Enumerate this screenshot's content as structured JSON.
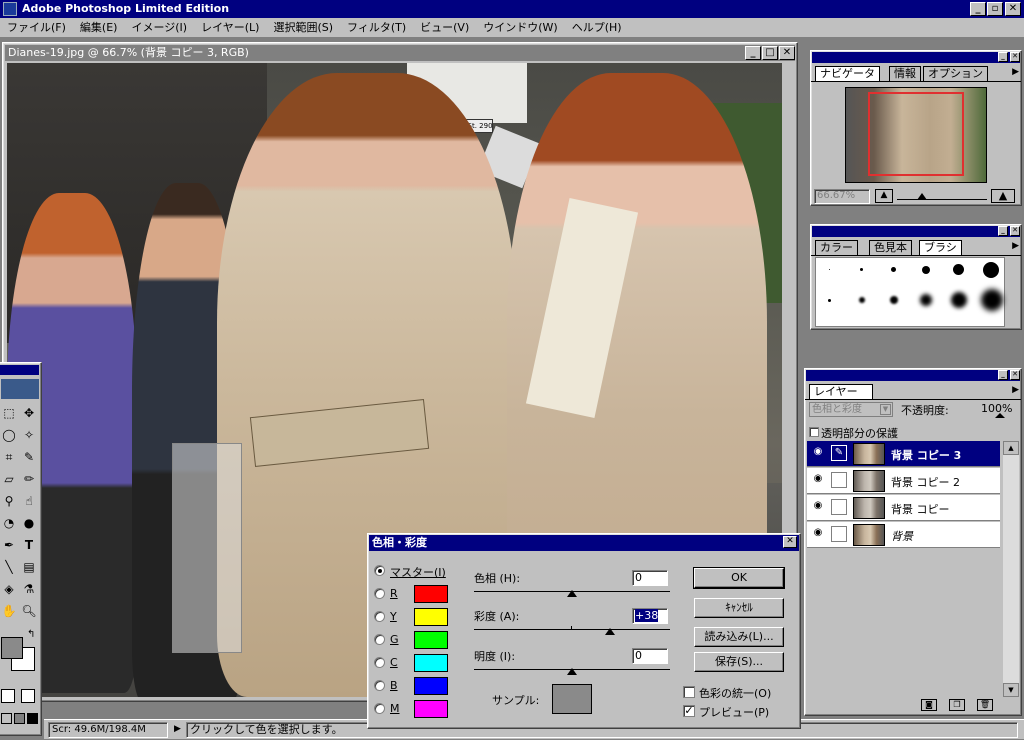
{
  "app": {
    "title": "Adobe Photoshop Limited Edition"
  },
  "menu": [
    "ファイル(F)",
    "編集(E)",
    "イメージ(I)",
    "レイヤー(L)",
    "選択範囲(S)",
    "フィルタ(T)",
    "ビュー(V)",
    "ウインドウ(W)",
    "ヘルプ(H)"
  ],
  "document": {
    "title": "Dianes-19.jpg @ 66.7% (背景 コピー 3, RGB)",
    "sign_text": "Granville St. 2900"
  },
  "navigator": {
    "tabs": [
      "ナビゲータ",
      "情報",
      "オプション"
    ],
    "zoom": "66.67%"
  },
  "brushes": {
    "tabs": [
      "カラー",
      "色見本",
      "ブラシ"
    ]
  },
  "layers": {
    "tab": "レイヤー",
    "blend_mode": "色相と彩度",
    "opacity_label": "不透明度:",
    "opacity_value": "100%",
    "preserve_label": "透明部分の保護",
    "rows": [
      {
        "name": "背景 コピー 3",
        "selected": true
      },
      {
        "name": "背景 コピー 2",
        "selected": false
      },
      {
        "name": "背景 コピー",
        "selected": false
      },
      {
        "name": "背景",
        "selected": false
      }
    ]
  },
  "status": {
    "scratch": "Scr: 49.6M/198.4M",
    "hint": "クリックして色を選択します。"
  },
  "dialog": {
    "title": "色相・彩度",
    "channels": [
      {
        "label": "マスター(I)",
        "color": "",
        "selected": true
      },
      {
        "label": "R",
        "color": "#ff0000",
        "selected": false
      },
      {
        "label": "Y",
        "color": "#ffff00",
        "selected": false
      },
      {
        "label": "G",
        "color": "#00ff00",
        "selected": false
      },
      {
        "label": "C",
        "color": "#00ffff",
        "selected": false
      },
      {
        "label": "B",
        "color": "#0000ff",
        "selected": false
      },
      {
        "label": "M",
        "color": "#ff00ff",
        "selected": false
      }
    ],
    "hue_label": "色相 (H):",
    "hue_value": "0",
    "sat_label": "彩度 (A):",
    "sat_value": "+38",
    "light_label": "明度 (I):",
    "light_value": "0",
    "sample_label": "サンプル:",
    "sample_color": "#8a8a8a",
    "buttons": {
      "ok": "OK",
      "cancel": "ｷｬﾝｾﾙ",
      "load": "読み込み(L)...",
      "save": "保存(S)..."
    },
    "colorize_label": "色彩の統一(O)",
    "preview_label": "プレビュー(P)",
    "colorize_checked": false,
    "preview_checked": true
  },
  "colors": {
    "titlebar": "#000080",
    "chrome": "#c0c0c0",
    "workspace": "#808080"
  }
}
